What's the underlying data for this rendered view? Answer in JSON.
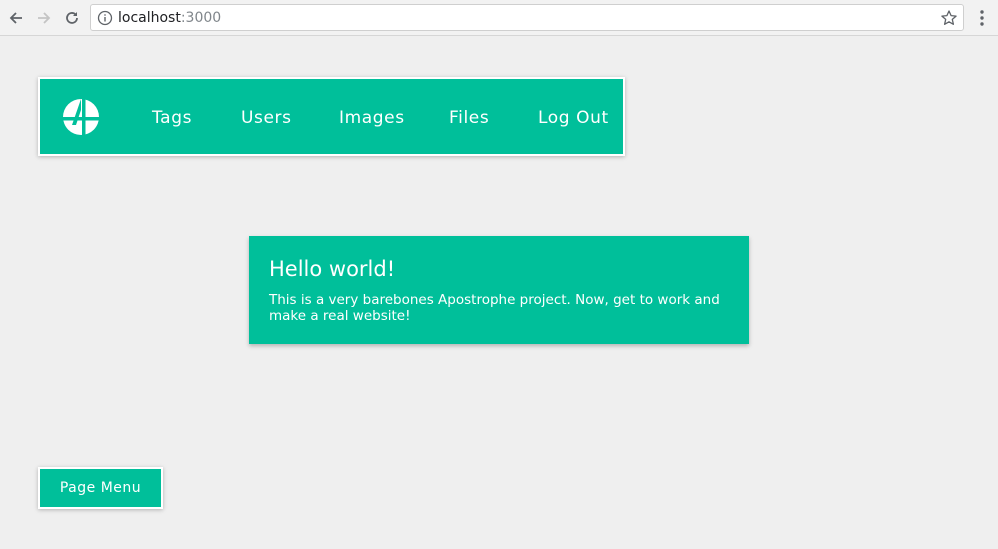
{
  "browser": {
    "url_host": "localhost",
    "url_port": ":3000",
    "icons": [
      "back-arrow-icon",
      "forward-arrow-icon",
      "reload-icon",
      "info-icon",
      "bookmark-star-icon",
      "menu-dots-icon"
    ]
  },
  "admin_bar": {
    "logo_icon": "apostrophe-logo-icon",
    "items": [
      {
        "label": "Tags"
      },
      {
        "label": "Users"
      },
      {
        "label": "Images"
      },
      {
        "label": "Files"
      },
      {
        "label": "Log Out"
      }
    ]
  },
  "card": {
    "title": "Hello world!",
    "body": "This is a very barebones Apostrophe project. Now, get to work and make a real website!"
  },
  "page_menu": {
    "label": "Page Menu"
  },
  "colors": {
    "accent": "#00bf9a",
    "background": "#efefef",
    "text_on_accent": "#ffffff"
  }
}
